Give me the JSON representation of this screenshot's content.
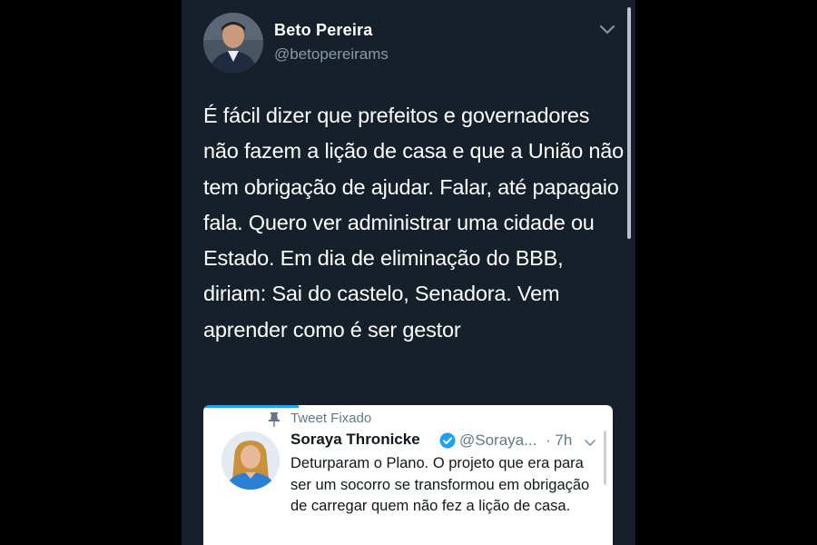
{
  "tweet": {
    "author": {
      "name": "Beto Pereira",
      "handle": "@betopereirams"
    },
    "text": "É fácil dizer que prefeitos e governadores não fazem a lição de casa e que a União não tem obrigação de ajudar. Falar, até papagaio fala. Quero ver administrar uma cidade ou Estado. Em dia de eliminação do BBB, diriam: Sai do castelo, Senadora. Vem aprender como é ser gestor",
    "menu_icon": "chevron-down-icon"
  },
  "quoted_tweet": {
    "pinned_label": "Tweet Fixado",
    "pinned_icon": "pin-icon",
    "author": {
      "name": "Soraya Thronicke",
      "handle": "@Soraya...",
      "verified": true
    },
    "time": "· 7h",
    "text": "Deturparam o Plano. O  projeto que era para ser um socorro se transformou em obrigação de carregar quem não fez a lição de casa."
  },
  "colors": {
    "background": "#15202b",
    "text": "#ffffff",
    "secondary_text": "#8899a6",
    "accent": "#1da1f2",
    "card_background": "#ffffff"
  }
}
